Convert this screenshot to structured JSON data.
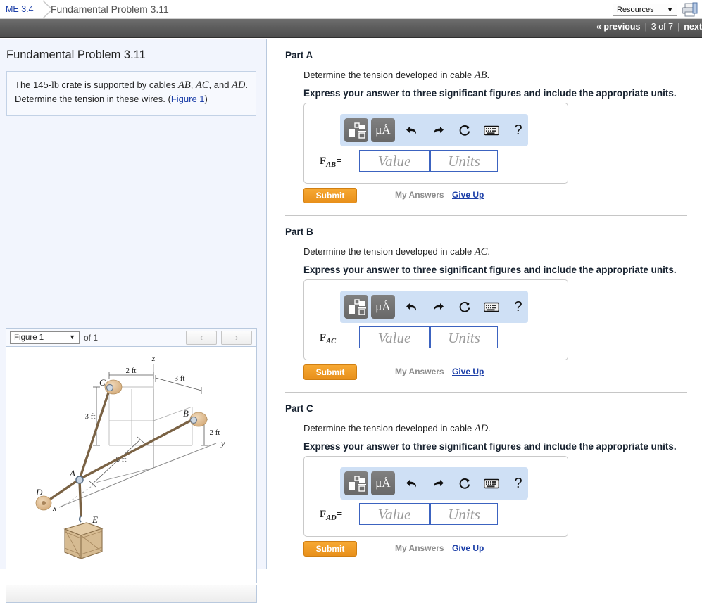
{
  "topbar": {
    "breadcrumb_link": "ME 3.4",
    "breadcrumb_title": "Fundamental Problem 3.11",
    "resources_label": "Resources",
    "resources_arrow": "▼",
    "print_icon_name": "printer-icon"
  },
  "nav": {
    "previous": "« previous",
    "pipe": "|",
    "page_indicator": "3 of 7",
    "next": "next"
  },
  "left": {
    "problem_title": "Fundamental Problem 3.11",
    "statement_part1": "The 145-",
    "statement_lb": "lb",
    "statement_part2": " crate is supported by cables ",
    "cable_ab": "AB",
    "comma1": ", ",
    "cable_ac": "AC",
    "and_text": ", and ",
    "cable_ad": "AD",
    "statement_part3": ". Determine the tension in these wires. (",
    "figure_link": "Figure 1",
    "statement_end": ")",
    "figure_select_value": "Figure 1",
    "figure_select_arrow": "▼",
    "figure_of": "of 1",
    "prev_figure": "‹",
    "next_figure": "›",
    "figure_labels": {
      "axis_z": "z",
      "axis_y": "y",
      "axis_x": "x",
      "point_a": "A",
      "point_b": "B",
      "point_c": "C",
      "point_d": "D",
      "point_e": "E",
      "dim_2ft_top": "2 ft",
      "dim_3ft_top": "3 ft",
      "dim_3ft_left": "3 ft",
      "dim_2ft_right": "2 ft",
      "dim_6ft": "6 ft"
    }
  },
  "parts": [
    {
      "title": "Part A",
      "question_pre": "Determine the tension developed in cable ",
      "question_var": "AB",
      "question_post": ".",
      "instruction": "Express your answer to three significant figures and include the appropriate units.",
      "var_label": "F",
      "var_sub": "AB",
      "equals": "=",
      "value_placeholder": "Value",
      "units_placeholder": "Units",
      "submit_label": "Submit",
      "my_answers_label": "My Answers",
      "give_up_label": "Give Up",
      "toolbar": {
        "template_icon": "math-template-icon",
        "units_label": "μÅ",
        "undo_icon": "undo-icon",
        "redo_icon": "redo-icon",
        "reset_icon": "reset-icon",
        "keyboard_icon": "keyboard-icon",
        "help_label": "?"
      }
    },
    {
      "title": "Part B",
      "question_pre": "Determine the tension developed in cable ",
      "question_var": "AC",
      "question_post": ".",
      "instruction": "Express your answer to three significant figures and include the appropriate units.",
      "var_label": "F",
      "var_sub": "AC",
      "equals": "=",
      "value_placeholder": "Value",
      "units_placeholder": "Units",
      "submit_label": "Submit",
      "my_answers_label": "My Answers",
      "give_up_label": "Give Up",
      "toolbar": {
        "template_icon": "math-template-icon",
        "units_label": "μÅ",
        "undo_icon": "undo-icon",
        "redo_icon": "redo-icon",
        "reset_icon": "reset-icon",
        "keyboard_icon": "keyboard-icon",
        "help_label": "?"
      }
    },
    {
      "title": "Part C",
      "question_pre": "Determine the tension developed in cable ",
      "question_var": "AD",
      "question_post": ".",
      "instruction": "Express your answer to three significant figures and include the appropriate units.",
      "var_label": "F",
      "var_sub": "AD",
      "equals": "=",
      "value_placeholder": "Value",
      "units_placeholder": "Units",
      "submit_label": "Submit",
      "my_answers_label": "My Answers",
      "give_up_label": "Give Up",
      "toolbar": {
        "template_icon": "math-template-icon",
        "units_label": "μÅ",
        "undo_icon": "undo-icon",
        "redo_icon": "redo-icon",
        "reset_icon": "reset-icon",
        "keyboard_icon": "keyboard-icon",
        "help_label": "?"
      }
    }
  ],
  "colors": {
    "link": "#1c3fa8",
    "submit_orange": "#e8901b",
    "toolbar_blue": "#cfe0f5",
    "panel_blue": "#f2f5fd",
    "nav_gray": "#5d5d5d",
    "input_border": "#3c63c0"
  }
}
